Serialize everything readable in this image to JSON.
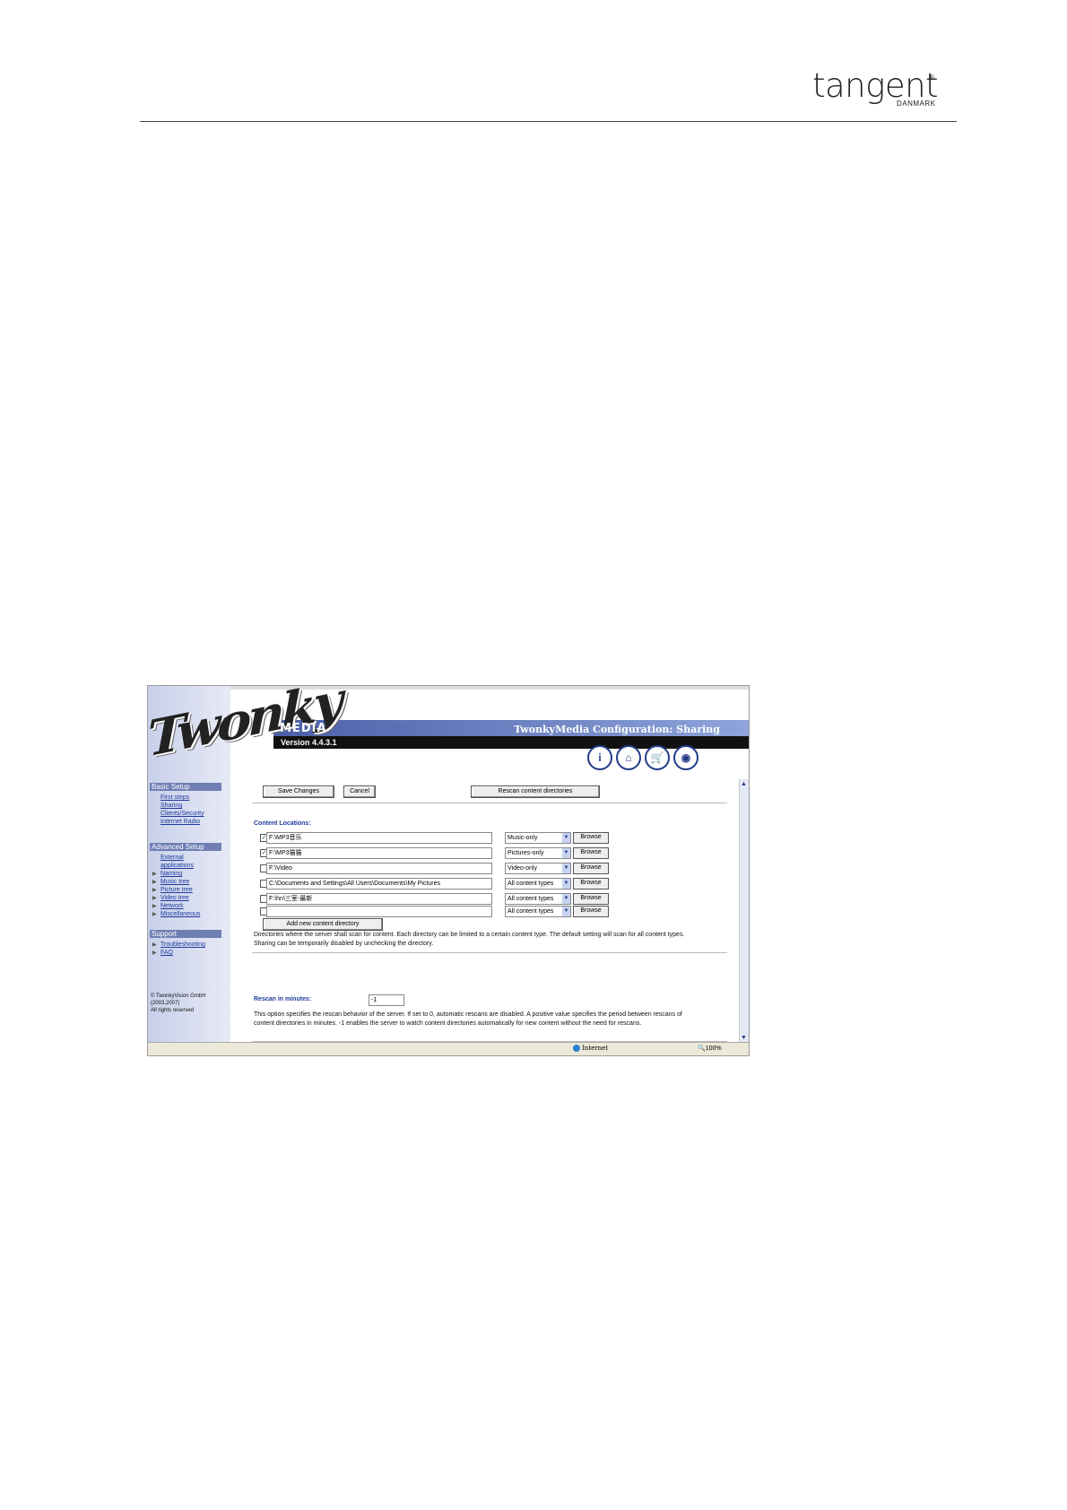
{
  "header": {
    "brand": "tangent",
    "brand_mark": "®",
    "brand_sub": "DANMARK"
  },
  "screenshot": {
    "logo_text": "Twonky",
    "media_label": "MEDIA",
    "version": "Version 4.4.3.1",
    "title": "TwonkyMedia Configuration: Sharing",
    "icons": [
      "info-icon",
      "home-icon",
      "cart-icon",
      "eye-icon"
    ],
    "sidebar": {
      "basic_setup": "Basic Setup",
      "basic_links": [
        "First steps",
        "Sharing",
        "Clients/Security",
        "Internet Radio"
      ],
      "advanced_setup": "Advanced Setup",
      "advanced_links": [
        "External",
        "applications",
        "Naming",
        "Music tree",
        "Picture tree",
        "Video tree",
        "Network",
        "Miscellaneous"
      ],
      "support": "Support",
      "support_links": [
        "Troubleshooting",
        "FAQ"
      ],
      "copyright": [
        "© TwonkyVision GmbH",
        "(2003,2007)",
        "All rights reserved"
      ]
    },
    "buttons": {
      "save": "Save Changes",
      "cancel": "Cancel",
      "rescan": "Rescan content directories",
      "add_dir": "Add new content directory"
    },
    "content_locations_label": "Content Locations:",
    "rows": [
      {
        "checked": true,
        "path": "F:\\MP3音乐",
        "type": "Music-only",
        "browse": "Browse"
      },
      {
        "checked": true,
        "path": "F:\\MP3猫猫",
        "type": "Pictures-only",
        "browse": "Browse"
      },
      {
        "checked": false,
        "path": "F:\\Video",
        "type": "Video-only",
        "browse": "Browse"
      },
      {
        "checked": false,
        "path": "C:\\Documents and Settings\\All Users\\Documents\\My Pictures",
        "type": "All content types",
        "browse": "Browse"
      },
      {
        "checked": false,
        "path": "F:\\hn\\三室-最新",
        "type": "All content types",
        "browse": "Browse"
      },
      {
        "checked": false,
        "path": "",
        "type": "All content types",
        "browse": "Browse"
      }
    ],
    "content_desc": "Directories where the server shall scan for content. Each directory can be limited to a certain content type. The default setting will scan for all content types. Sharing can be temporarily disabled by unchecking the directory.",
    "rescan_label": "Rescan in minutes:",
    "rescan_value": "-1",
    "rescan_desc": "This option specifies the rescan behavior of the server. If set to 0, automatic rescans are disabled. A positive value specifies the period between rescans of content directories in minutes. -1 enables the server to watch content directories automatically for new content without the need for rescans.",
    "status": {
      "zone": "Internet",
      "zoom": "100%"
    }
  }
}
